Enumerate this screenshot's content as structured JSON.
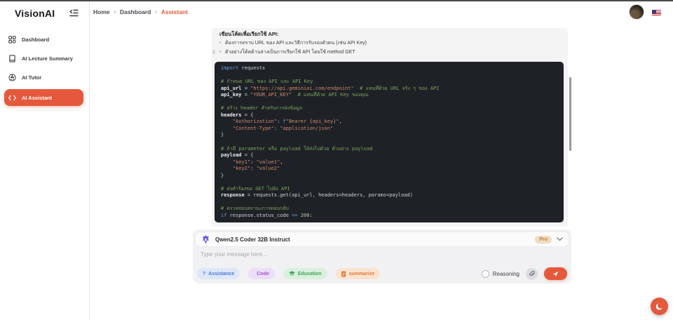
{
  "sidebar": {
    "logo": "VisionAI",
    "items": [
      {
        "label": "Dashboard",
        "icon": "grid-icon",
        "active": false
      },
      {
        "label": "AI Lecture Summary",
        "icon": "book-icon",
        "active": false
      },
      {
        "label": "AI Tutor",
        "icon": "globe-icon",
        "active": false
      },
      {
        "label": "AI Assistant",
        "icon": "code-icon",
        "active": true
      }
    ]
  },
  "breadcrumb": {
    "items": [
      "Home",
      "Dashboard",
      "Assistant"
    ],
    "active": "Assistant"
  },
  "message": {
    "heading": "เขียนโค้ดเพื่อเรียกใช้ API:",
    "bullets": [
      {
        "prefix": "",
        "marker": "•",
        "text": "ต้องการทราบ URL ของ API และวิธีการรับรองตัวตน (เช่น API Key)"
      },
      {
        "prefix": "2.",
        "marker": "•",
        "text": "ตัวอย่างโค้ดด้านล่างเป็นการเรียกใช้ API โดยใช้ method GET"
      }
    ]
  },
  "code": {
    "language": "python",
    "lines": [
      [
        [
          "k",
          "import"
        ],
        [
          "p",
          " requests"
        ]
      ],
      [],
      [
        [
          "c",
          "# กำหนด URL ของ API และ API Key"
        ]
      ],
      [
        [
          "v",
          "api_url"
        ],
        [
          "p",
          " = "
        ],
        [
          "s",
          "\"https://api.geminiai.com/endpoint\""
        ],
        [
          "p",
          "  "
        ],
        [
          "c",
          "# แทนที่ด้วย URL จริง ๆ ของ API"
        ]
      ],
      [
        [
          "v",
          "api_key"
        ],
        [
          "p",
          " = "
        ],
        [
          "s",
          "\"YOUR_API_KEY\""
        ],
        [
          "p",
          "  "
        ],
        [
          "c",
          "# แทนที่ด้วย API Key ของคุณ"
        ]
      ],
      [],
      [
        [
          "c",
          "# สร้าง header สำหรับการส่งข้อมูล"
        ]
      ],
      [
        [
          "v",
          "headers"
        ],
        [
          "p",
          " = {"
        ]
      ],
      [
        [
          "p",
          "    "
        ],
        [
          "s",
          "\"Authorization\""
        ],
        [
          "p",
          ": "
        ],
        [
          "k",
          "f"
        ],
        [
          "s",
          "\"Bearer {api_key}\""
        ],
        [
          "p",
          ","
        ]
      ],
      [
        [
          "p",
          "    "
        ],
        [
          "s",
          "\"Content-Type\""
        ],
        [
          "p",
          ": "
        ],
        [
          "s",
          "\"application/json\""
        ]
      ],
      [
        [
          "p",
          "}"
        ]
      ],
      [],
      [
        [
          "c",
          "# ถ้ามี parameter หรือ payload ให้ส่งไปด้วย ตัวอย่าง payload"
        ]
      ],
      [
        [
          "v",
          "payload"
        ],
        [
          "p",
          " = {"
        ]
      ],
      [
        [
          "p",
          "    "
        ],
        [
          "s",
          "\"key1\""
        ],
        [
          "p",
          ": "
        ],
        [
          "s",
          "\"value1\""
        ],
        [
          "p",
          ","
        ]
      ],
      [
        [
          "p",
          "    "
        ],
        [
          "s",
          "\"key2\""
        ],
        [
          "p",
          ": "
        ],
        [
          "s",
          "\"value2\""
        ]
      ],
      [
        [
          "p",
          "}"
        ]
      ],
      [],
      [
        [
          "c",
          "# ส่งคำร้องขอ GET ไปยัง API"
        ]
      ],
      [
        [
          "v",
          "response"
        ],
        [
          "p",
          " = requests.get(api_url, headers=headers, params=payload)"
        ]
      ],
      [],
      [
        [
          "c",
          "# ตรวจสอบสถานะการตอบกลับ"
        ]
      ],
      [
        [
          "k",
          "if"
        ],
        [
          "p",
          " response.status_code "
        ],
        [
          "k",
          "=="
        ],
        [
          "p",
          " "
        ],
        [
          "n",
          "200"
        ],
        [
          "p",
          ":"
        ]
      ]
    ]
  },
  "chat": {
    "model": {
      "name": "Qwen2.5 Coder 32B Instruct",
      "badge": "Pro",
      "icon": "qwen-logo"
    },
    "input_placeholder": "Type your message here...",
    "tags": [
      {
        "label": "Assistance",
        "icon": "question-icon",
        "bg": "#dde7f8",
        "color": "#4f7ad1"
      },
      {
        "label": "Code",
        "icon": "code-icon",
        "bg": "#ecdef8",
        "color": "#a257d4"
      },
      {
        "label": "Education",
        "icon": "graduation-cap-icon",
        "bg": "#d9f0de",
        "color": "#43a25c"
      },
      {
        "label": "summarize",
        "icon": "document-icon",
        "bg": "#fbe3d0",
        "color": "#e0793c"
      }
    ],
    "reasoning_label": "Reasoning"
  },
  "colors": {
    "accent": "#e4593b",
    "code_bg": "#1e2126",
    "panel_bg": "#f4f4f5"
  }
}
